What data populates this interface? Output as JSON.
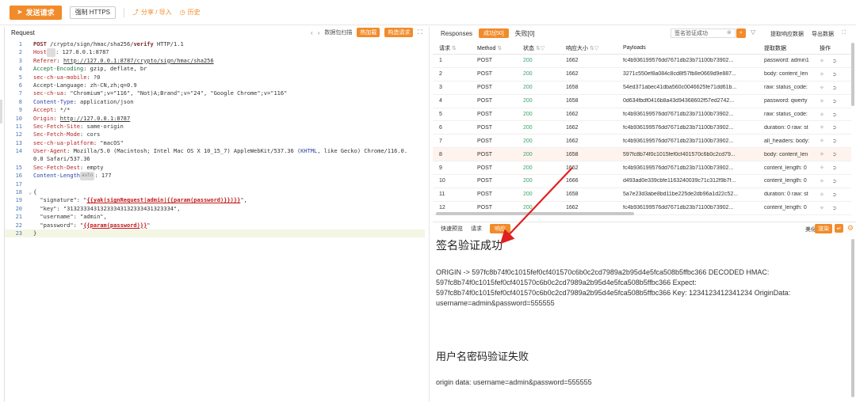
{
  "toolbar": {
    "send_label": "发送请求",
    "https_label": "强制 HTTPS",
    "share_label": "分享 / 导入",
    "history_label": "历史"
  },
  "request": {
    "title": "Request",
    "scan_label": "数据包扫描",
    "hotload_label": "热加载",
    "build_label": "构造请求",
    "lines": [
      {
        "n": "1",
        "parts": [
          [
            "k-method",
            "POST"
          ],
          [
            "txt",
            " /crypto/sign/hmac/sha256/"
          ],
          [
            "k-method",
            "verify"
          ],
          [
            "txt",
            " HTTP/1.1 "
          ]
        ]
      },
      {
        "n": "2",
        "parts": [
          [
            "k-red",
            "Host"
          ],
          [
            "badge-mini",
            "  "
          ],
          [
            "txt",
            ": 127.0.0.1:8787 "
          ]
        ]
      },
      {
        "n": "3",
        "parts": [
          [
            "k-red",
            "Referer"
          ],
          [
            "txt",
            ": "
          ],
          [
            "k-under",
            "http://127.0.0.1:8787/crypto/sign/hmac/sha256"
          ],
          [
            "txt",
            " "
          ]
        ]
      },
      {
        "n": "4",
        "parts": [
          [
            "k-green",
            "Accept-Encoding"
          ],
          [
            "txt",
            ": gzip, deflate, br "
          ]
        ]
      },
      {
        "n": "5",
        "parts": [
          [
            "k-red",
            "sec-ch-ua-mobile"
          ],
          [
            "txt",
            ": ?0 "
          ]
        ]
      },
      {
        "n": "6",
        "parts": [
          [
            "txt",
            "Accept-Language: zh-CN,zh;q=0.9 "
          ]
        ]
      },
      {
        "n": "7",
        "parts": [
          [
            "k-red",
            "sec-ch-ua"
          ],
          [
            "txt",
            ": \"Chromium\";v=\"116\", \"Not)A;Brand\";v=\"24\", \"Google Chrome\";v=\"116\" "
          ]
        ]
      },
      {
        "n": "8",
        "parts": [
          [
            "k-blue",
            "Content-Type"
          ],
          [
            "txt",
            ": application/json "
          ]
        ]
      },
      {
        "n": "9",
        "parts": [
          [
            "k-red",
            "Accept"
          ],
          [
            "txt",
            ": */* "
          ]
        ]
      },
      {
        "n": "10",
        "parts": [
          [
            "k-red",
            "Origin"
          ],
          [
            "txt",
            ": "
          ],
          [
            "k-under",
            "http://127.0.0.1:8787"
          ],
          [
            "txt",
            " "
          ]
        ]
      },
      {
        "n": "11",
        "parts": [
          [
            "k-red",
            "Sec-Fetch-Site"
          ],
          [
            "txt",
            ": same-origin "
          ]
        ]
      },
      {
        "n": "12",
        "parts": [
          [
            "k-red",
            "Sec-Fetch-Mode"
          ],
          [
            "txt",
            ": cors "
          ]
        ]
      },
      {
        "n": "13",
        "parts": [
          [
            "k-red",
            "sec-ch-ua-platform"
          ],
          [
            "txt",
            ": \"macOS\" "
          ]
        ]
      },
      {
        "n": "14",
        "parts": [
          [
            "k-red",
            "User-Agent"
          ],
          [
            "txt",
            ": Mozilla/5.0 (Macintosh; Intel Mac OS X 10_15_7) AppleWebKit/537.36 ("
          ],
          [
            "k-blue",
            "KHTML"
          ],
          [
            "txt",
            ", like Gecko) Chrome/116.0."
          ]
        ]
      },
      {
        "n": "",
        "parts": [
          [
            "txt",
            "0.0 Safari/537.36 "
          ]
        ]
      },
      {
        "n": "15",
        "parts": [
          [
            "k-red",
            "Sec-Fetch-Dest"
          ],
          [
            "txt",
            ": empty "
          ]
        ]
      },
      {
        "n": "16",
        "parts": [
          [
            "k-blue",
            "Content-Length"
          ],
          [
            "badge-mini",
            "auto"
          ],
          [
            "txt",
            ": 177 "
          ]
        ]
      },
      {
        "n": "17",
        "parts": [
          [
            "txt",
            " "
          ]
        ]
      },
      {
        "n": "18",
        "fold": true,
        "parts": [
          [
            "txt",
            "{ "
          ]
        ]
      },
      {
        "n": "19",
        "parts": [
          [
            "txt",
            "  \"signature\": \""
          ],
          [
            "k-tpl",
            "{{yak(signRequest|admin|{{param(password)}})}}"
          ],
          [
            "txt",
            "\", "
          ]
        ]
      },
      {
        "n": "20",
        "parts": [
          [
            "txt",
            "  \"key\": \"31323334313233343132333431323334\", "
          ]
        ]
      },
      {
        "n": "21",
        "parts": [
          [
            "txt",
            "  \"username\": \"admin\", "
          ]
        ]
      },
      {
        "n": "22",
        "parts": [
          [
            "txt",
            "  \"password\": \""
          ],
          [
            "k-tpl",
            "{{param(password)}}"
          ],
          [
            "txt",
            "\""
          ]
        ]
      },
      {
        "n": "23",
        "active": true,
        "parts": [
          [
            "txt",
            "}"
          ]
        ]
      }
    ]
  },
  "responses": {
    "title": "Responses",
    "ok_tab": "成功[50]",
    "fail_tab": "失败[0]",
    "search_value": "签名验证成功",
    "extract_label": "提取响应数据",
    "export_label": "导出数据",
    "columns": [
      "请求",
      "Method",
      "状态",
      "响应大小",
      "Payloads",
      "提取数据",
      "操作"
    ],
    "rows": [
      {
        "id": "1",
        "method": "POST",
        "status": "200",
        "size": "1662",
        "payload": "fc4b936199576dd7671db23b71100b73902...",
        "extract": "password: admin1"
      },
      {
        "id": "2",
        "method": "POST",
        "status": "200",
        "size": "1662",
        "payload": "3271c550ef8a084c8cd8f57fb8e0669d9e887...",
        "extract": "body: content_len"
      },
      {
        "id": "3",
        "method": "POST",
        "status": "200",
        "size": "1658",
        "payload": "54ed371abec41dba560c0046625fe71dd61b...",
        "extract": "raw: status_code:"
      },
      {
        "id": "4",
        "method": "POST",
        "status": "200",
        "size": "1658",
        "payload": "0d634fbdf0416b8a43d94368602f57ed2742...",
        "extract": "password: qwerty"
      },
      {
        "id": "5",
        "method": "POST",
        "status": "200",
        "size": "1662",
        "payload": "fc4b936199576dd7671db23b71100b73902...",
        "extract": "raw: status_code:"
      },
      {
        "id": "6",
        "method": "POST",
        "status": "200",
        "size": "1662",
        "payload": "fc4b936199576dd7671db23b71100b73902...",
        "extract": "duration: 0 raw: st"
      },
      {
        "id": "7",
        "method": "POST",
        "status": "200",
        "size": "1662",
        "payload": "fc4b936199576dd7671db23b71100b73902...",
        "extract": "all_headers: body:"
      },
      {
        "id": "8",
        "method": "POST",
        "status": "200",
        "size": "1658",
        "payload": "597fc8b74f0c1015fef0cf401570c6b0c2cd79...",
        "extract": "body: content_len",
        "hl": true
      },
      {
        "id": "9",
        "method": "POST",
        "status": "200",
        "size": "1662",
        "payload": "fc4b936199576dd7671db23b71100b73902...",
        "extract": "content_length: 0"
      },
      {
        "id": "10",
        "method": "POST",
        "status": "200",
        "size": "1666",
        "payload": "d493ad0e339cbfe1163240039c71c312f9b7f...",
        "extract": "content_length: 0"
      },
      {
        "id": "11",
        "method": "POST",
        "status": "200",
        "size": "1658",
        "payload": "5a7e23d3abe8bd11be225de2db96a1d22c52...",
        "extract": "duration: 0 raw: st"
      },
      {
        "id": "12",
        "method": "POST",
        "status": "200",
        "size": "1662",
        "payload": "fc4b936199576dd7671db23b71100b73902...",
        "extract": "content_length: 0"
      }
    ]
  },
  "detail": {
    "tabs": [
      "快速预览",
      "请求",
      "响应"
    ],
    "beautify_label": "美化",
    "render_label": "渲染",
    "heading_ok": "签名验证成功",
    "para_ok": "ORIGIN -> 597fc8b74f0c1015fef0cf401570c6b0c2cd7989a2b95d4e5fca508b5ffbc366 DECODED HMAC: 597fc8b74f0c1015fef0cf401570c6b0c2cd7989a2b95d4e5fca508b5ffbc366 Expect: 597fc8b74f0c1015fef0cf401570c6b0c2cd7989a2b95d4e5fca508b5ffbc366 Key: 1234123412341234 OriginData: username=admin&password=555555",
    "heading_fail": "用户名密码验证失败",
    "para_fail": "origin data: username=admin&password=555555"
  },
  "colors": {
    "accent": "#f28b2a",
    "arrow": "#e02020",
    "ok_status": "#3aa36a"
  }
}
